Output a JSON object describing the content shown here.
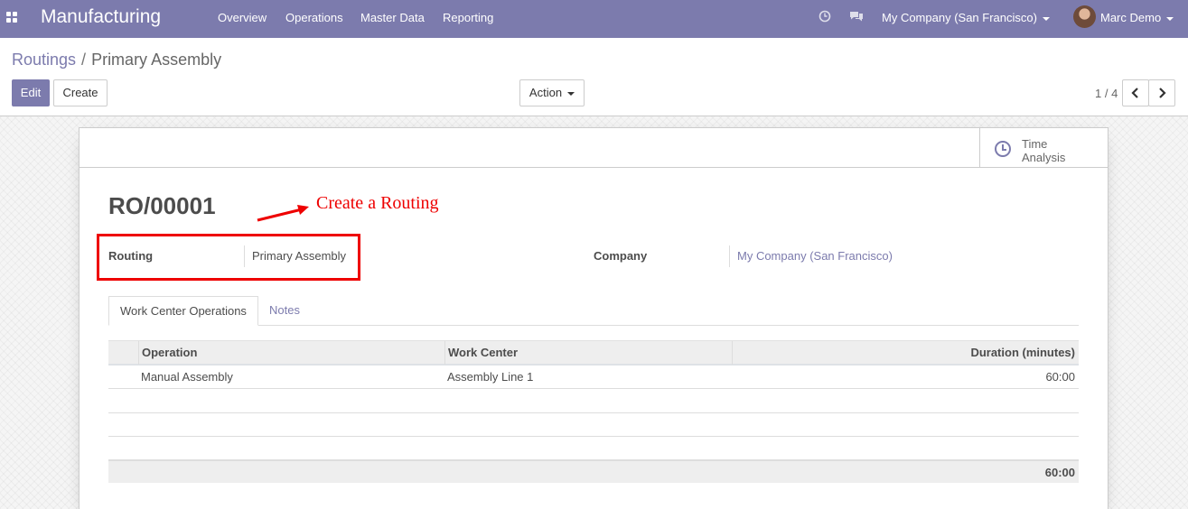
{
  "navbar": {
    "app_name": "Manufacturing",
    "menus": [
      "Overview",
      "Operations",
      "Master Data",
      "Reporting"
    ],
    "company": "My Company (San Francisco)",
    "user": "Marc Demo",
    "color": "#7c7bad"
  },
  "breadcrumb": {
    "parent": "Routings",
    "separator": "/",
    "current": "Primary Assembly"
  },
  "buttons": {
    "edit": "Edit",
    "create": "Create",
    "action": "Action"
  },
  "pager": {
    "value": "1 / 4"
  },
  "stat_buttons": {
    "time_analysis_line1": "Time",
    "time_analysis_line2": "Analysis"
  },
  "record": {
    "reference": "RO/00001"
  },
  "annotation": {
    "text": "Create a Routing",
    "color": "#ee0000"
  },
  "fields": {
    "routing_label": "Routing",
    "routing_value": "Primary Assembly",
    "company_label": "Company",
    "company_value": "My Company (San Francisco)"
  },
  "tabs": [
    "Work Center Operations",
    "Notes"
  ],
  "table": {
    "headers": [
      "Operation",
      "Work Center",
      "Duration (minutes)"
    ],
    "rows": [
      {
        "operation": "Manual Assembly",
        "work_center": "Assembly Line 1",
        "duration": "60:00"
      }
    ],
    "total_duration": "60:00"
  }
}
